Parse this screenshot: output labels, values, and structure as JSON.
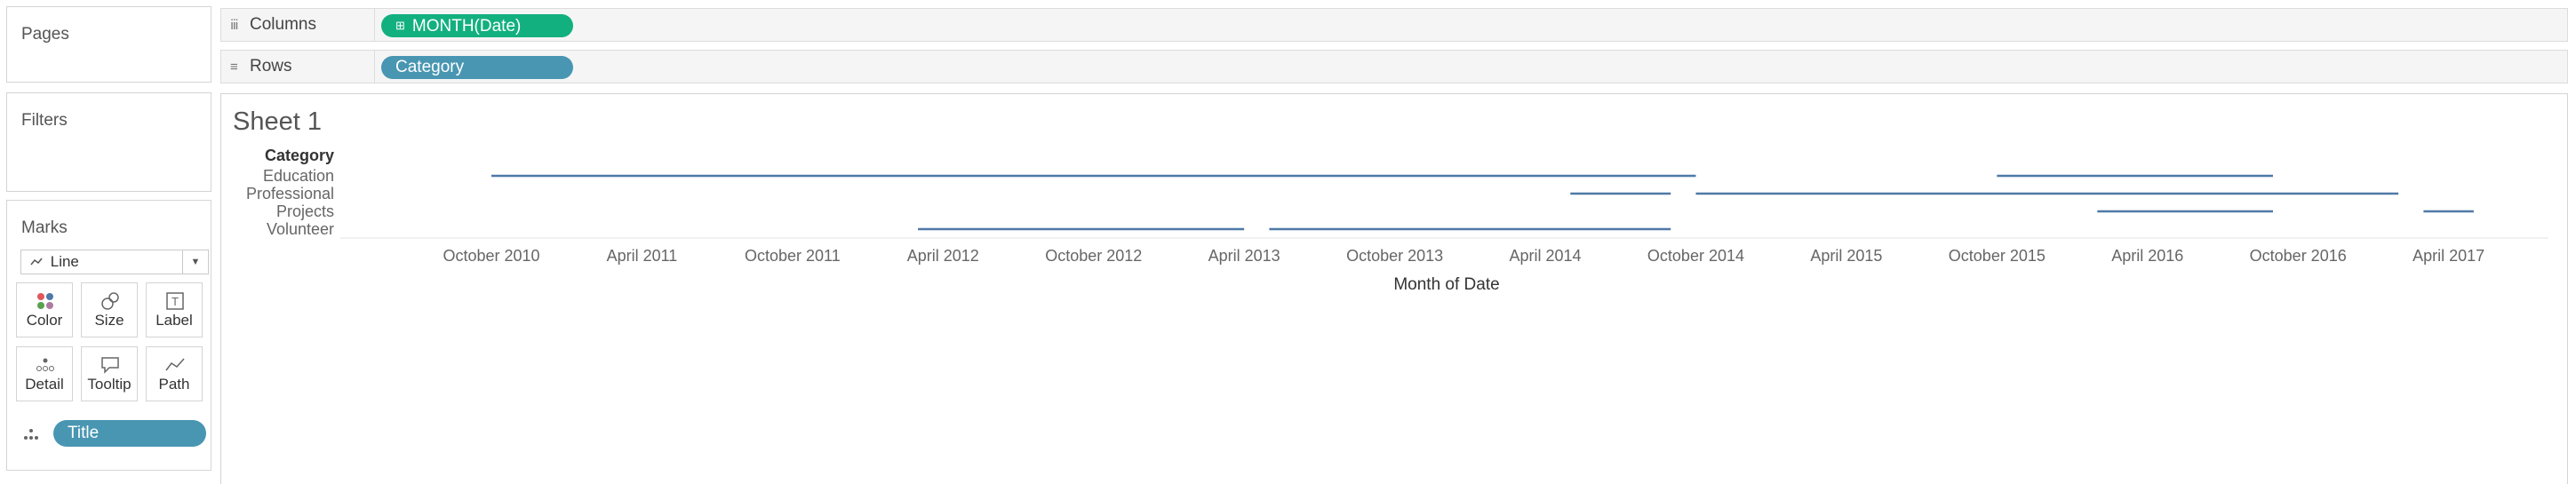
{
  "cards": {
    "pages_title": "Pages",
    "filters_title": "Filters",
    "marks_title": "Marks"
  },
  "shelves": {
    "columns_label": "Columns",
    "columns_pill": "MONTH(Date)",
    "rows_label": "Rows",
    "rows_pill": "Category"
  },
  "marks": {
    "type": "Line",
    "buttons": [
      "Color",
      "Size",
      "Label",
      "Detail",
      "Tooltip",
      "Path"
    ],
    "field_pill": "Title"
  },
  "sheet": {
    "title": "Sheet 1"
  },
  "colors": {
    "line": "#4e79a7",
    "green_pill": "#13b07f",
    "blue_pill": "#4996b2"
  },
  "chart_data": {
    "type": "line",
    "row_header": "Category",
    "xlabel": "Month of Date",
    "x_ticks": [
      "October 2010",
      "April 2011",
      "October 2011",
      "April 2012",
      "October 2012",
      "April 2013",
      "October 2013",
      "April 2014",
      "October 2014",
      "April 2015",
      "October 2015",
      "April 2016",
      "October 2016",
      "April 2017"
    ],
    "xlim": [
      "2010-10",
      "2017-05"
    ],
    "categories": [
      "Education",
      "Professional",
      "Projects",
      "Volunteer"
    ],
    "segments": [
      {
        "category": "Education",
        "start": "2010-10",
        "end": "2014-10"
      },
      {
        "category": "Education",
        "start": "2015-10",
        "end": "2016-09"
      },
      {
        "category": "Professional",
        "start": "2014-05",
        "end": "2014-09"
      },
      {
        "category": "Professional",
        "start": "2014-10",
        "end": "2017-02"
      },
      {
        "category": "Projects",
        "start": "2016-02",
        "end": "2016-09"
      },
      {
        "category": "Projects",
        "start": "2017-03",
        "end": "2017-05"
      },
      {
        "category": "Volunteer",
        "start": "2012-03",
        "end": "2013-04"
      },
      {
        "category": "Volunteer",
        "start": "2013-05",
        "end": "2014-09"
      }
    ]
  }
}
